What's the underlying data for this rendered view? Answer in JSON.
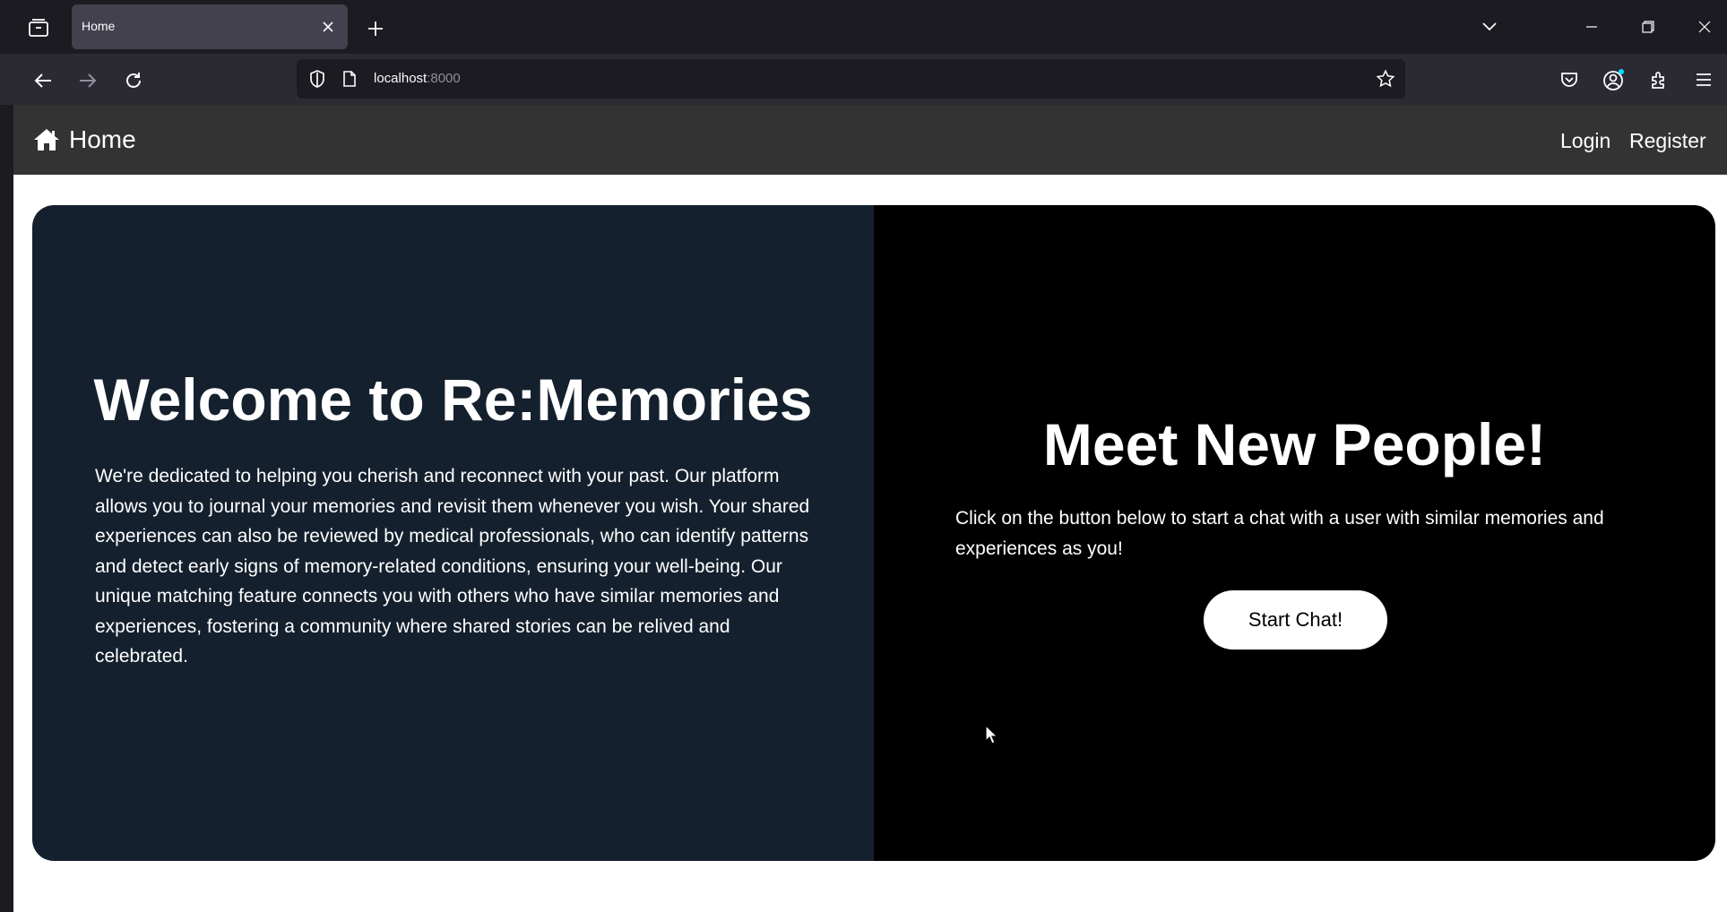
{
  "browser": {
    "tab": {
      "title": "Home"
    },
    "address": {
      "host": "localhost",
      "port": ":8000"
    },
    "icons": {
      "tab_list": "tab-list-icon",
      "tab_close": "close-icon",
      "new_tab": "plus-icon",
      "tab_overflow": "chevron-down-icon",
      "back": "back-arrow-icon",
      "forward": "forward-arrow-icon",
      "reload": "reload-icon",
      "shield": "shield-icon",
      "page": "page-icon",
      "bookmark": "star-icon",
      "pocket": "pocket-icon",
      "account": "account-icon",
      "extensions": "puzzle-icon",
      "menu": "hamburger-menu-icon"
    },
    "colors": {
      "chrome_dark": "#1c1b22",
      "toolbar": "#2b2a33",
      "active_tab": "#42414d",
      "account_badge": "#00ddff"
    }
  },
  "site": {
    "brand": {
      "label": "Home",
      "icon": "home-icon"
    },
    "nav": {
      "login": "Login",
      "register": "Register"
    },
    "welcome": {
      "title": "Welcome to Re:Memories",
      "text": "We're dedicated to helping you cherish and reconnect with your past. Our platform allows you to journal your memories and revisit them whenever you wish. Your shared experiences can also be reviewed by medical professionals, who can identify patterns and detect early signs of memory-related conditions, ensuring your well-being. Our unique matching feature connects you with others who have similar memories and experiences, fostering a community where shared stories can be relived and celebrated."
    },
    "meet": {
      "title": "Meet New People!",
      "text": "Click on the button below to start a chat with a user with similar memories and experiences as you!",
      "button": "Start Chat!"
    },
    "colors": {
      "navbar": "#333333",
      "left_panel": "#15202e",
      "right_panel": "#000000",
      "button": "#ffffff"
    }
  }
}
